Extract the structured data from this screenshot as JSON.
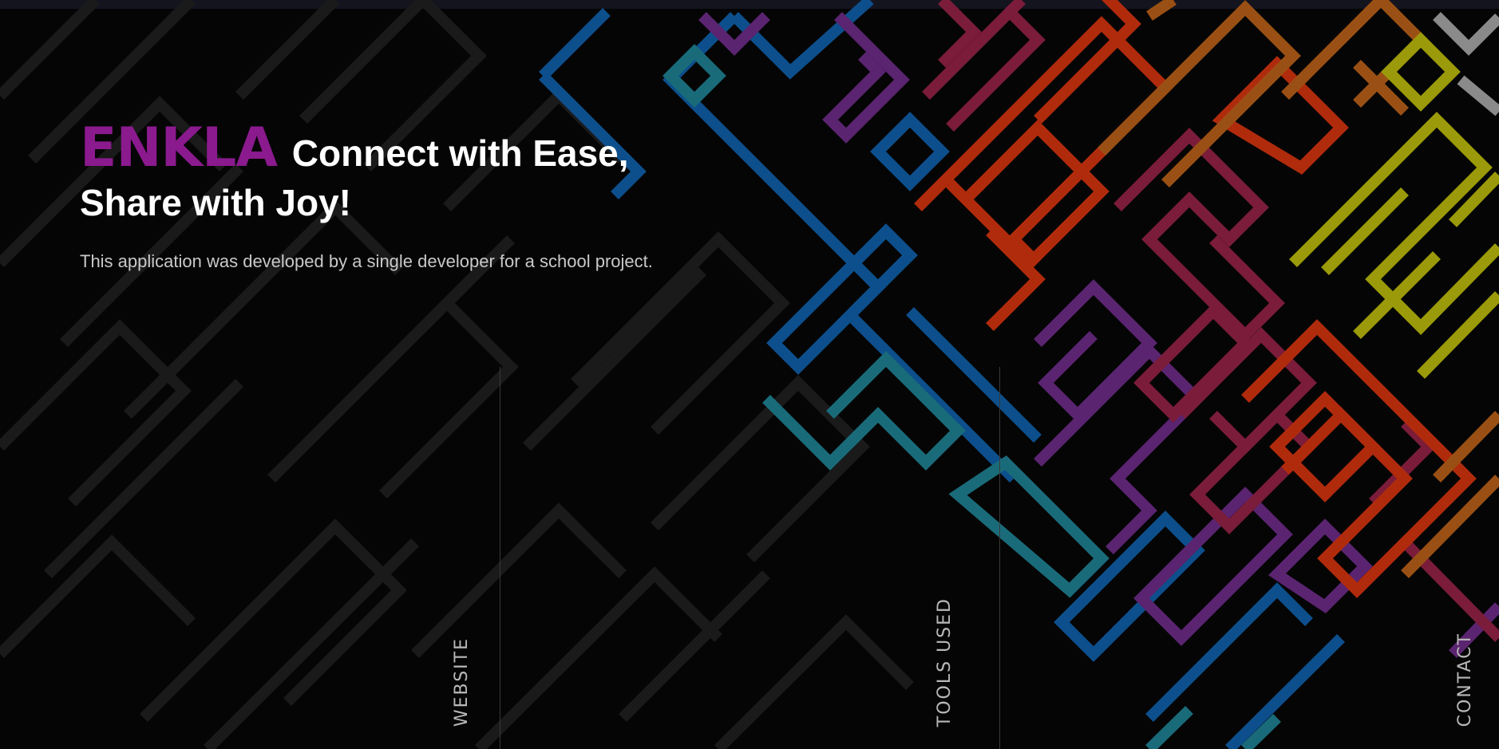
{
  "hero": {
    "brand": "ENKLA",
    "headline_line1": "Connect with Ease,",
    "headline_line2": "Share with Joy!",
    "subtitle": "This application was developed by a single developer for a school project."
  },
  "sections": {
    "website": "WEBSITE",
    "tools_used": "TOOLS USED",
    "contact": "CONTACT"
  },
  "colors": {
    "brand": "#8b1a8e",
    "background": "#050505",
    "text": "#ffffff",
    "muted_text": "#c9c9c9"
  }
}
